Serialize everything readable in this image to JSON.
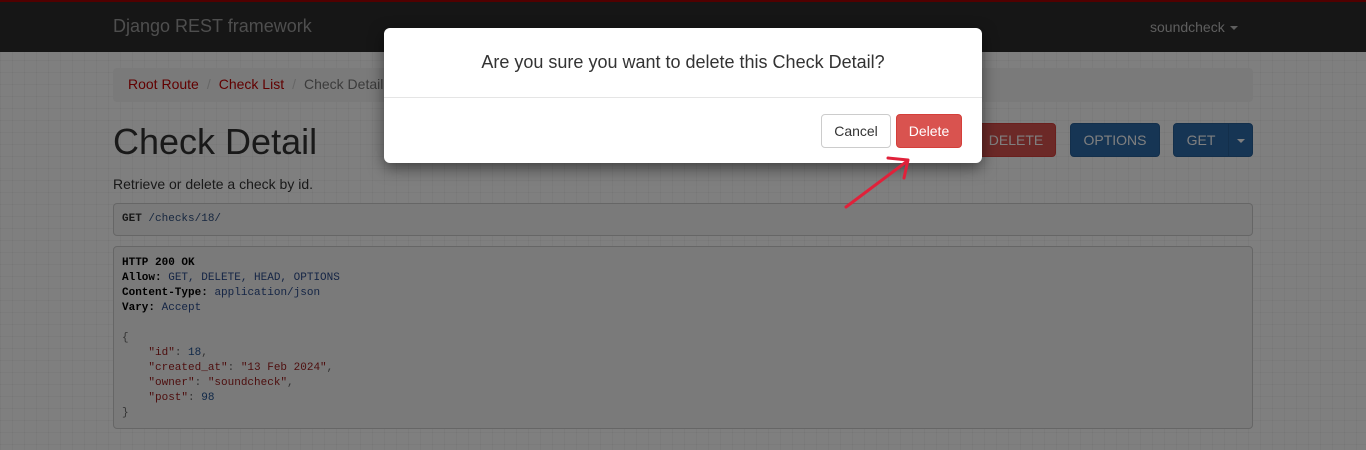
{
  "navbar": {
    "brand": "Django REST framework",
    "user": "soundcheck"
  },
  "breadcrumb": {
    "items": [
      "Root Route",
      "Check List",
      "Check Detail"
    ]
  },
  "page": {
    "title": "Check Detail",
    "description": "Retrieve or delete a check by id."
  },
  "actions": {
    "delete": "DELETE",
    "options": "OPTIONS",
    "get": "GET"
  },
  "request": {
    "method": "GET",
    "path": "/checks/18/"
  },
  "response": {
    "status": "HTTP 200 OK",
    "headers": [
      {
        "name": "Allow:",
        "value": "GET, DELETE, HEAD, OPTIONS"
      },
      {
        "name": "Content-Type:",
        "value": "application/json"
      },
      {
        "name": "Vary:",
        "value": "Accept"
      }
    ],
    "body": [
      {
        "key": "\"id\"",
        "value": "18",
        "kind": "num"
      },
      {
        "key": "\"created_at\"",
        "value": "\"13 Feb 2024\"",
        "kind": "str"
      },
      {
        "key": "\"owner\"",
        "value": "\"soundcheck\"",
        "kind": "str"
      },
      {
        "key": "\"post\"",
        "value": "98",
        "kind": "num"
      }
    ]
  },
  "modal": {
    "question": "Are you sure you want to delete this Check Detail?",
    "cancel": "Cancel",
    "delete": "Delete"
  },
  "colors": {
    "navbar_bg": "#2c2c2c",
    "link_red": "#c20000",
    "danger": "#d9534f",
    "primary": "#2c6aa8",
    "arrow": "#e0213a"
  },
  "icons": {
    "user_menu": "chevron-down-icon",
    "get_dropdown": "chevron-down-icon",
    "annotation": "arrow-icon"
  }
}
